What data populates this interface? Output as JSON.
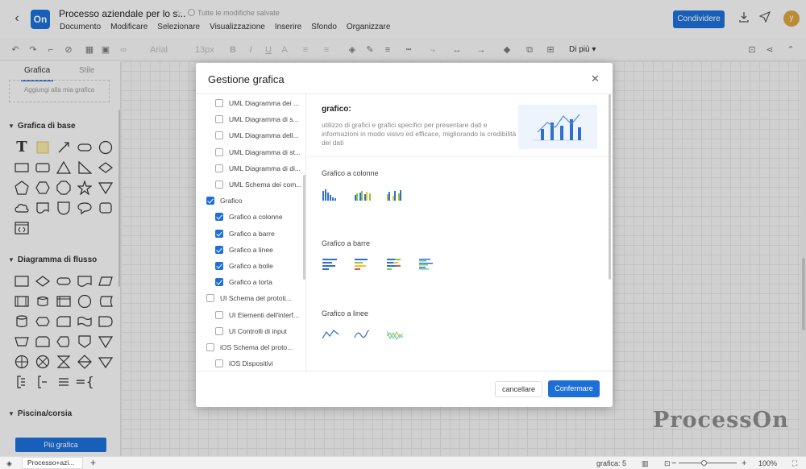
{
  "header": {
    "doc_title": "Processo aziendale per lo s...",
    "saved_status": "Tutte le modifiche salvate",
    "logo_text": "On",
    "avatar_initial": "y",
    "share_label": "Condividere",
    "menu": [
      "Documento",
      "Modificare",
      "Selezionare",
      "Visualizzazione",
      "Inserire",
      "Sfondo",
      "Organizzare"
    ]
  },
  "toolbar": {
    "font_name": "Arial",
    "font_size": "13px",
    "more_label": "Di più"
  },
  "sidebar": {
    "tabs": [
      "Grafica",
      "Stile"
    ],
    "active_tab": "Grafica",
    "add_label": "Aggiungi alla mia grafica",
    "sections": [
      "Grafica di base",
      "Diagramma di flusso",
      "Piscina/corsia"
    ],
    "more_shapes_label": "Più grafica"
  },
  "dialog": {
    "title": "Gestione grafica",
    "tree": [
      {
        "label": "UML Diagramma dei ...",
        "checked": false,
        "level": 2
      },
      {
        "label": "UML Diagramma di s...",
        "checked": false,
        "level": 2
      },
      {
        "label": "UML Diagramma dell...",
        "checked": false,
        "level": 2
      },
      {
        "label": "UML Diagramma di st...",
        "checked": false,
        "level": 2
      },
      {
        "label": "UML Diagramma di di...",
        "checked": false,
        "level": 2
      },
      {
        "label": "UML Schema dei com...",
        "checked": false,
        "level": 2
      },
      {
        "label": "Grafico",
        "checked": true,
        "level": 1
      },
      {
        "label": "Grafico a colonne",
        "checked": true,
        "level": 2
      },
      {
        "label": "Grafico a barre",
        "checked": true,
        "level": 2
      },
      {
        "label": "Grafico a linee",
        "checked": true,
        "level": 2
      },
      {
        "label": "Grafico a bolle",
        "checked": true,
        "level": 2
      },
      {
        "label": "Grafico a torta",
        "checked": true,
        "level": 2
      },
      {
        "label": "UI Schema del prototi...",
        "checked": false,
        "level": 1
      },
      {
        "label": "UI Elementi dell'interf...",
        "checked": false,
        "level": 2
      },
      {
        "label": "UI Controlli di input",
        "checked": false,
        "level": 2
      },
      {
        "label": "iOS Schema del proto...",
        "checked": false,
        "level": 1
      },
      {
        "label": "iOS Dispositivi",
        "checked": false,
        "level": 2
      }
    ],
    "info_title": "grafico:",
    "info_desc": "utilizzo di grafici e grafici specifici per presentare dati e informazioni in modo visivo ed efficace, migliorando la credibilità dei dati",
    "categories": [
      "Grafico a colonne",
      "Grafico a barre",
      "Grafico a linee"
    ],
    "cancel_label": "cancellare",
    "confirm_label": "Confermare"
  },
  "watermark": "ProcessOn",
  "bottom": {
    "page_tab": "Processo+azi...",
    "count_label": "grafica: 5",
    "zoom_label": "100%",
    "zoom_fraction": 0.45
  },
  "colors": {
    "accent": "#1d6fd8",
    "chart_blue": "#2f6fce",
    "chart_green": "#8cc63f",
    "chart_yellow": "#f2c12e",
    "chart_red": "#e0554d",
    "chart_teal": "#5bc0c4"
  }
}
